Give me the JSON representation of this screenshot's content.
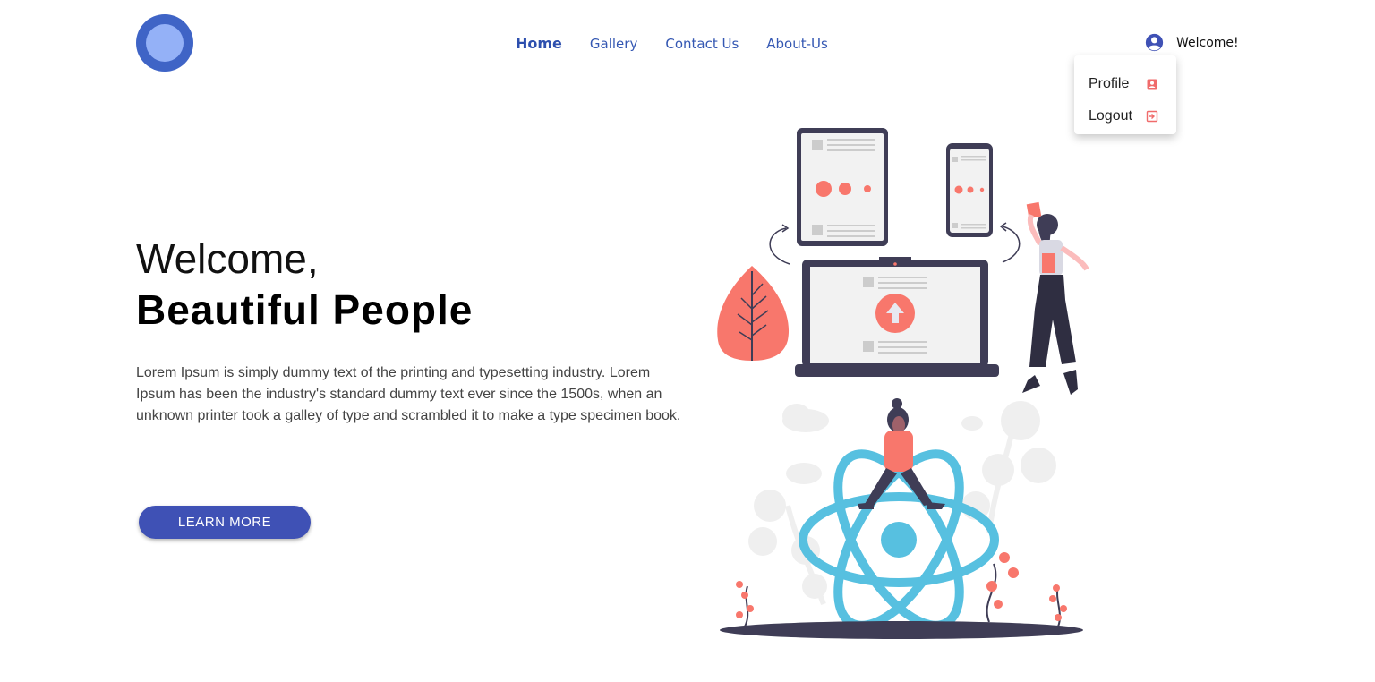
{
  "header": {
    "nav": [
      {
        "label": "Home"
      },
      {
        "label": "Gallery"
      },
      {
        "label": "Contact Us"
      },
      {
        "label": "About-Us"
      }
    ],
    "welcome_label": "Welcome!"
  },
  "user_menu": {
    "items": [
      {
        "label": "Profile",
        "icon": "contact-card-icon"
      },
      {
        "label": "Logout",
        "icon": "exit-icon"
      }
    ]
  },
  "hero": {
    "title_line1": "Welcome,",
    "title_line2": "Beautiful People",
    "description": "Lorem Ipsum is simply dummy text of the printing and typesetting industry. Lorem Ipsum has been the industry's standard dummy text ever since the 1500s, when an unknown printer took a galley of type and scrambled it to make a type specimen book.",
    "cta_label": "LEARN MORE"
  },
  "colors": {
    "brand_blue": "#3f64c6",
    "button": "#3f51b5",
    "accent_coral": "#f8776c",
    "react_blue": "#57c0e0",
    "dark_navy": "#3f3d56"
  }
}
